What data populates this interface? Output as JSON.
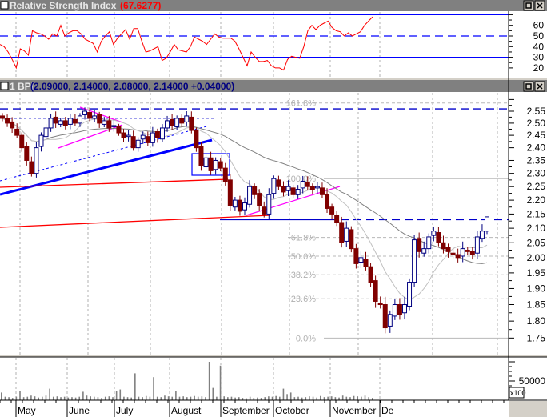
{
  "rsi_panel": {
    "title": "Relative Strength Index",
    "value": "(67.6277)"
  },
  "price_panel": {
    "title": "1 BPI",
    "ohlc_text": "(2.09000, 2.14000, 2.08000, 2.14000 +0.04000)"
  },
  "volume_panel": {
    "scale_label": "x100"
  },
  "colors": {
    "up_candle": "#000080",
    "down_candle": "#800000",
    "rsi_line": "#ff0000",
    "header_bg": "#808080",
    "ma_long": "#808080",
    "ma_short": "#c0c0c0"
  },
  "chart_data": [
    {
      "type": "line",
      "title": "Relative Strength Index",
      "y_ticks": [
        "60",
        "50",
        "40",
        "30",
        "20"
      ],
      "ylim": [
        12,
        72
      ],
      "reference_lines": [
        70,
        50,
        30
      ],
      "values": [
        42,
        40,
        35,
        28,
        20,
        38,
        36,
        32,
        55,
        53,
        52,
        50,
        47,
        52,
        50,
        60,
        50,
        53,
        55,
        55,
        52,
        47,
        45,
        43,
        35,
        45,
        50,
        54,
        42,
        48,
        52,
        56,
        47,
        57,
        57,
        45,
        35,
        36,
        38,
        40,
        27,
        29,
        35,
        42,
        37,
        36,
        35,
        40,
        49,
        47,
        45,
        42,
        47,
        52,
        49,
        48,
        48,
        48,
        45,
        38,
        30,
        22,
        35,
        30,
        26,
        26,
        27,
        22,
        20,
        20,
        18,
        28,
        31,
        30,
        29,
        40,
        55,
        60,
        56,
        60,
        62,
        64,
        58,
        55,
        54,
        50,
        53,
        50,
        52,
        54,
        60,
        64,
        68
      ]
    },
    {
      "type": "candlestick",
      "title": "1 BPI",
      "y_scale": "log",
      "ylim": [
        1.73,
        2.59
      ],
      "y_ticks": [
        "2.55",
        "2.50",
        "2.45",
        "2.40",
        "2.35",
        "2.30",
        "2.25",
        "2.20",
        "2.15",
        "2.10",
        "2.05",
        "2.00",
        "1.95",
        "1.90",
        "1.85",
        "1.80",
        "1.75"
      ],
      "last_bar": {
        "open": 2.09,
        "high": 2.14,
        "low": 2.08,
        "close": 2.14,
        "change": 0.04
      },
      "close": [
        2.52,
        2.5,
        2.48,
        2.45,
        2.4,
        2.35,
        2.3,
        2.4,
        2.45,
        2.48,
        2.52,
        2.5,
        2.51,
        2.49,
        2.52,
        2.5,
        2.53,
        2.55,
        2.52,
        2.53,
        2.5,
        2.51,
        2.48,
        2.49,
        2.46,
        2.44,
        2.45,
        2.4,
        2.43,
        2.45,
        2.42,
        2.46,
        2.44,
        2.48,
        2.51,
        2.49,
        2.52,
        2.5,
        2.53,
        2.47,
        2.4,
        2.33,
        2.36,
        2.31,
        2.35,
        2.32,
        2.27,
        2.18,
        2.2,
        2.16,
        2.19,
        2.25,
        2.22,
        2.18,
        2.15,
        2.22,
        2.28,
        2.25,
        2.23,
        2.25,
        2.22,
        2.24,
        2.27,
        2.25,
        2.24,
        2.25,
        2.22,
        2.17,
        2.15,
        2.12,
        2.05,
        2.1,
        2.03,
        1.98,
        2.0,
        1.97,
        1.92,
        1.86,
        1.85,
        1.78,
        1.82,
        1.85,
        1.82,
        1.85,
        1.92,
        2.06,
        2.02,
        2.03,
        2.07,
        2.09,
        2.05,
        2.03,
        2.02,
        2.01,
        2.0,
        2.03,
        2.02,
        2.01,
        2.07,
        2.09,
        2.14
      ],
      "fibonacci": [
        {
          "label": "161.8%",
          "price": 2.585
        },
        {
          "label": "100.0%",
          "price": 2.28
        },
        {
          "label": "61.8%",
          "price": 2.068
        },
        {
          "label": "50.0%",
          "price": 2.005
        },
        {
          "label": "38.2%",
          "price": 1.944
        },
        {
          "label": "23.6%",
          "price": 1.868
        },
        {
          "label": "0.0%",
          "price": 1.75
        }
      ],
      "resistance_levels": [
        2.56,
        2.13
      ]
    },
    {
      "type": "bar",
      "title": "Volume",
      "y_ticks": [
        "50000"
      ],
      "ylim": [
        0,
        105000
      ],
      "values": [
        20000,
        9000,
        8000,
        6000,
        9000,
        25000,
        8000,
        9000,
        12000,
        10000,
        7000,
        9000,
        12000,
        30000,
        9000,
        10000,
        8000,
        9000,
        7000,
        8000,
        7000,
        9000,
        22000,
        12000,
        10000,
        9000,
        8000,
        6000,
        9000,
        10000,
        8000,
        23000,
        28000,
        9000,
        8000,
        7000,
        70000,
        9000,
        8000,
        11000,
        9000,
        60000,
        9000,
        8000,
        12000,
        10000,
        9000,
        25000,
        9000,
        10000,
        8000,
        9000,
        11000,
        9000,
        10000,
        8000,
        100000,
        32000,
        9000,
        90000,
        10000,
        8000,
        9000,
        7000,
        8000,
        6000,
        5000,
        9000,
        6000,
        7000,
        6000,
        8000,
        10000,
        9000,
        11000,
        9000,
        30000,
        16000,
        20000,
        8000,
        9000,
        7000,
        8000,
        10000,
        9000,
        7000,
        11000,
        8000,
        9000,
        10000,
        8000,
        7000,
        12000,
        9000,
        8000,
        11000,
        10000,
        9000,
        12000,
        8000,
        6000
      ],
      "x_labels": [
        "May",
        "June",
        "July",
        "August",
        "September",
        "October",
        "November",
        "De"
      ]
    }
  ]
}
